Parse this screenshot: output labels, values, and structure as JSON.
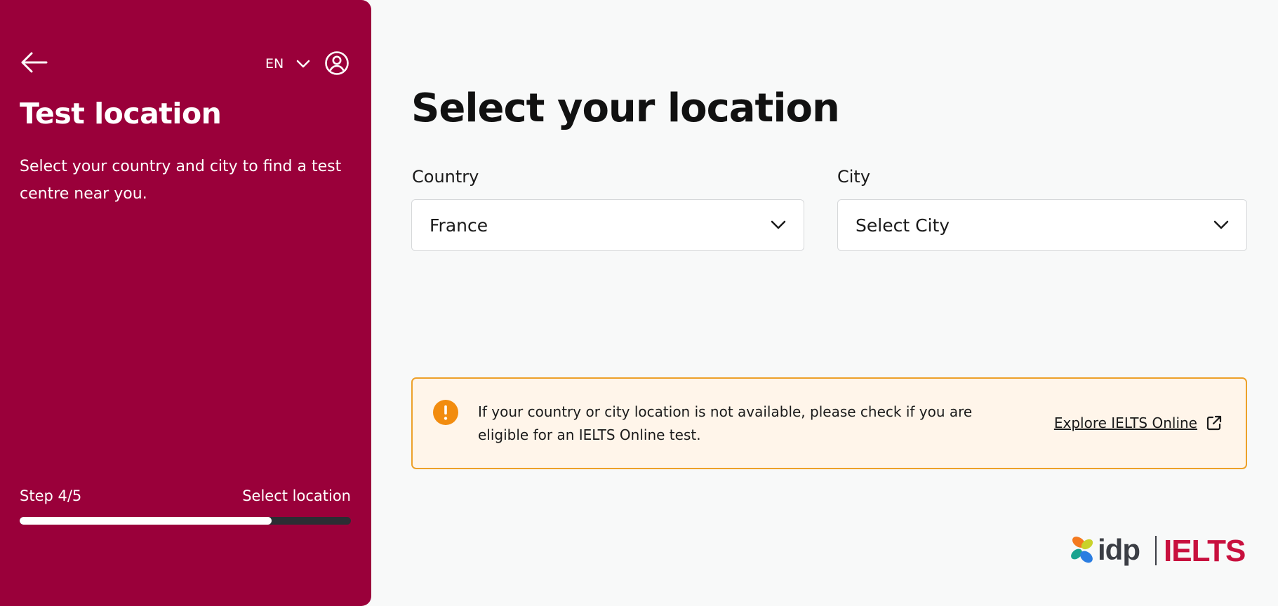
{
  "sidebar": {
    "back_icon": "arrow-left-icon",
    "language": "EN",
    "language_icon": "chevron-down-icon",
    "account_icon": "user-circle-icon",
    "title": "Test location",
    "description": "Select your country and city to find a test centre near you.",
    "step_label": "Step 4/5",
    "step_name": "Select location",
    "progress": 0.76
  },
  "main": {
    "title": "Select your location",
    "country": {
      "label": "Country",
      "value": "France"
    },
    "city": {
      "label": "City",
      "value": "Select City"
    },
    "alert": {
      "icon": "exclamation-circle-icon",
      "message": "If your country or city location is not available, please check if you are eligible for an IELTS Online test.",
      "link_label": "Explore IELTS Online",
      "link_icon": "external-link-icon"
    }
  },
  "brand": {
    "company": "idp",
    "product": "IELTS"
  },
  "colors": {
    "panel": "#9a003a",
    "alert_border": "#eda12a",
    "alert_bg": "#fff5ea",
    "alert_icon": "#f28c0f",
    "ielts_red": "#c8103e"
  }
}
